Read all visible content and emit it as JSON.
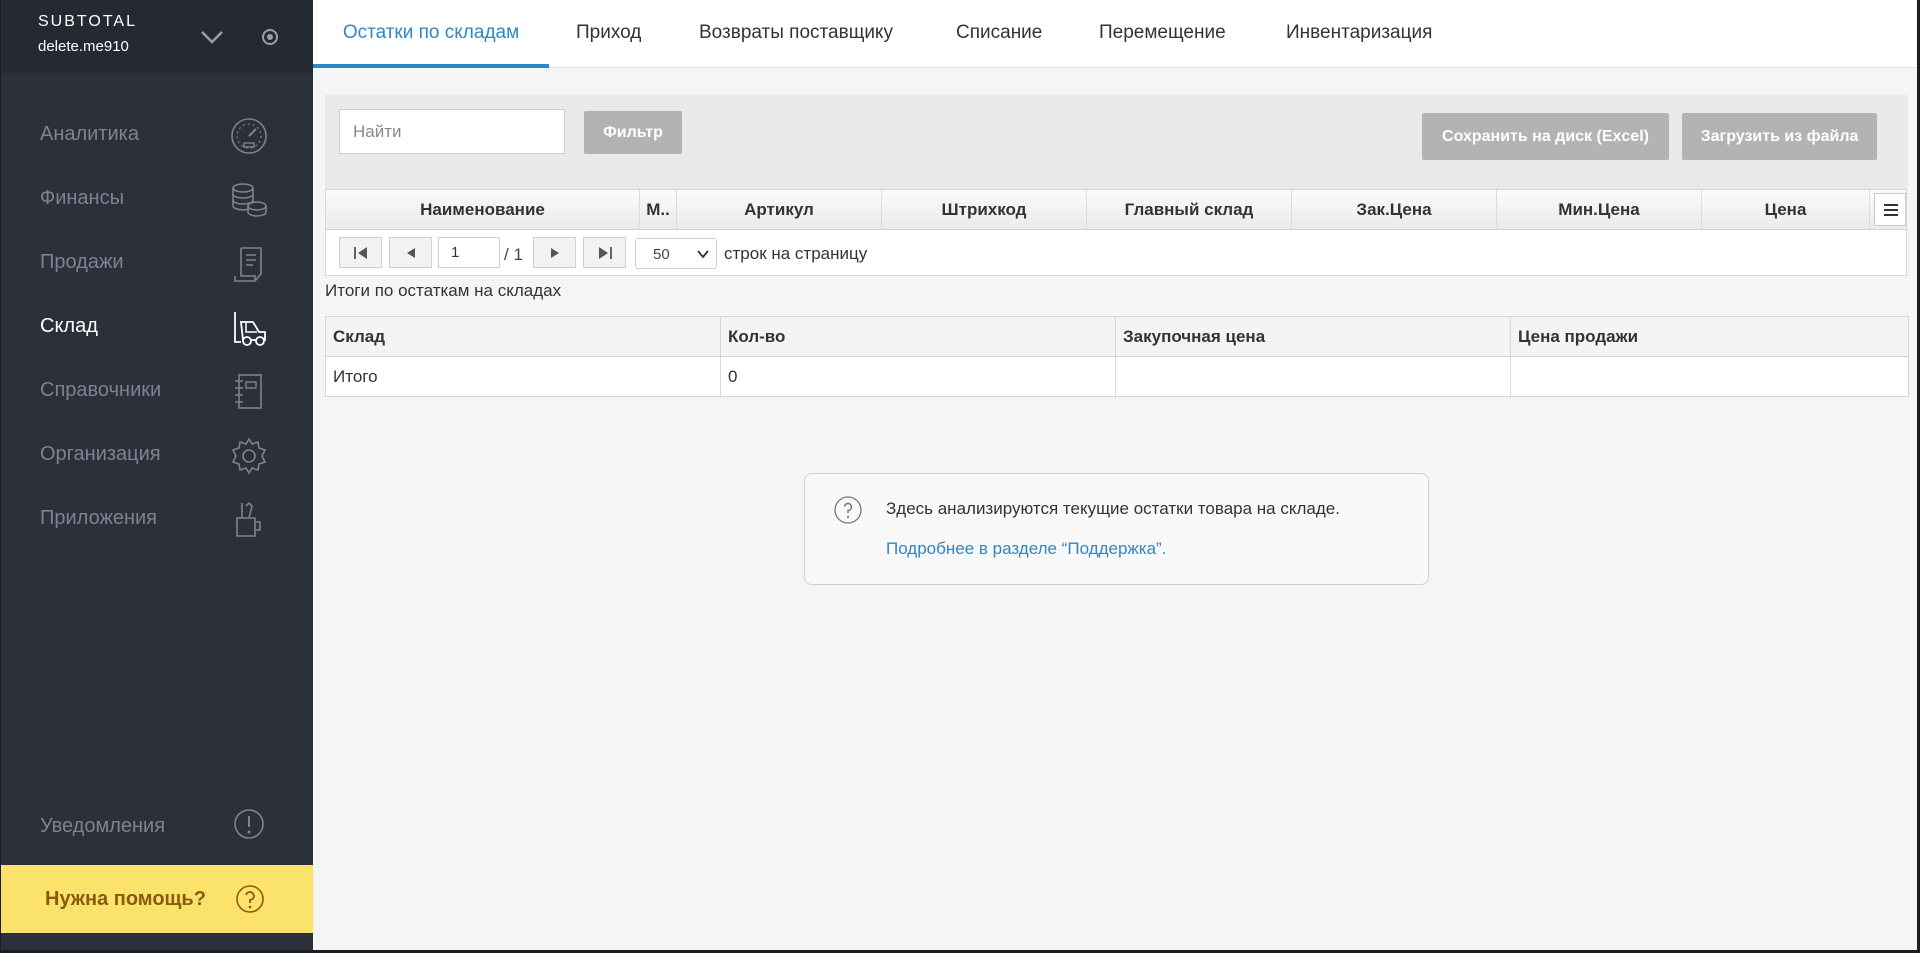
{
  "brand": {
    "name": "SUBTOTAL",
    "user": "delete.me910"
  },
  "sidebar": {
    "items": [
      {
        "label": "Аналитика",
        "icon": "speedometer-icon"
      },
      {
        "label": "Финансы",
        "icon": "coins-icon"
      },
      {
        "label": "Продажи",
        "icon": "receipt-icon"
      },
      {
        "label": "Склад",
        "icon": "forklift-icon",
        "active": true
      },
      {
        "label": "Справочники",
        "icon": "notebook-icon"
      },
      {
        "label": "Организация",
        "icon": "gear-icon"
      },
      {
        "label": "Приложения",
        "icon": "tools-cup-icon"
      }
    ],
    "notifications": "Уведомления",
    "help": "Нужна помощь?"
  },
  "tabs": [
    {
      "label": "Остатки по складам",
      "active": true
    },
    {
      "label": "Приход"
    },
    {
      "label": "Возвраты поставщику"
    },
    {
      "label": "Списание"
    },
    {
      "label": "Перемещение"
    },
    {
      "label": "Инвентаризация"
    }
  ],
  "toolbar": {
    "search_placeholder": "Найти",
    "filter_label": "Фильтр",
    "save_label": "Сохранить на диск (Excel)",
    "load_label": "Загрузить из файла"
  },
  "grid": {
    "columns": [
      "Наименование",
      "М..",
      "Артикул",
      "Штрихкод",
      "Главный склад",
      "Зак.Цена",
      "Мин.Цена",
      "Цена"
    ]
  },
  "pager": {
    "page": "1",
    "total": "/ 1",
    "page_size": "50",
    "rows_label": "строк на страницу"
  },
  "summary": {
    "title": "Итоги по остаткам на складах",
    "columns": [
      "Склад",
      "Кол-во",
      "Закупочная цена",
      "Цена продажи"
    ],
    "rows": [
      [
        "Итого",
        "0",
        "",
        ""
      ]
    ]
  },
  "info": {
    "text": "Здесь анализируются текущие остатки товара на складе.",
    "link": "Подробнее в разделе “Поддержка”."
  },
  "colors": {
    "accent": "#2f86c6",
    "sidebar": "#2b303b",
    "help": "#fbe36b"
  }
}
